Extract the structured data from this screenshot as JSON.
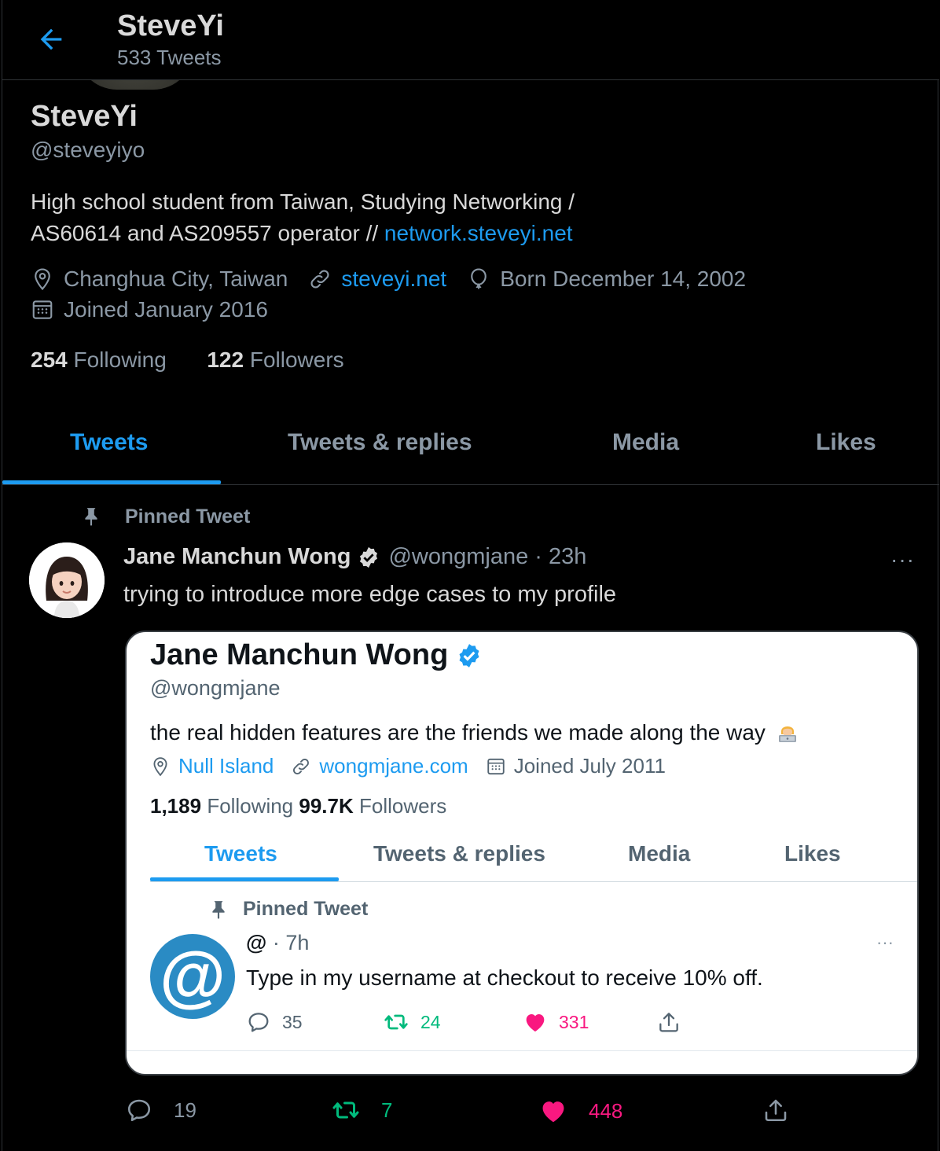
{
  "header": {
    "title": "SteveYi",
    "tweet_count": "533 Tweets"
  },
  "profile": {
    "name": "SteveYi",
    "handle": "@steveyiyo",
    "bio_line1": "High school student from Taiwan, Studying Networking /",
    "bio_line2": "AS60614 and AS209557 operator // ",
    "bio_link": "network.steveyi.net",
    "location": "Changhua City, Taiwan",
    "website": "steveyi.net",
    "birthday": "Born December 14, 2002",
    "joined": "Joined January 2016",
    "following_count": "254",
    "following_label": "Following",
    "followers_count": "122",
    "followers_label": "Followers"
  },
  "tabs": [
    {
      "label": "Tweets",
      "active": true
    },
    {
      "label": "Tweets & replies",
      "active": false
    },
    {
      "label": "Media",
      "active": false
    },
    {
      "label": "Likes",
      "active": false
    }
  ],
  "tweet": {
    "pinned_label": "Pinned Tweet",
    "author_name": "Jane Manchun Wong",
    "author_handle": "@wongmjane",
    "time": "· 23h",
    "more": "···",
    "text": "trying to introduce more edge cases to my profile",
    "reply_count": "19",
    "retweet_count": "7",
    "like_count": "448"
  },
  "embedded": {
    "name": "Jane Manchun Wong",
    "handle": "@wongmjane",
    "bio": "the real hidden features are the friends we made along the way",
    "location": "Null Island",
    "website": "wongmjane.com",
    "joined": "Joined July 2011",
    "following_count": "1,189",
    "following_label": "Following",
    "followers_count": "99.7K",
    "followers_label": "Followers",
    "tabs": [
      "Tweets",
      "Tweets & replies",
      "Media",
      "Likes"
    ],
    "pinned_label": "Pinned Tweet",
    "tweet_author": "@",
    "tweet_time": "· 7h",
    "tweet_more": "···",
    "tweet_text": "Type in my username at checkout to receive 10% off.",
    "avatar_glyph": "@",
    "reply_count": "35",
    "retweet_count": "24",
    "like_count": "331"
  },
  "colors": {
    "accent": "#1d9bf0",
    "retweet": "#00ba7c",
    "like": "#f91880",
    "muted": "#8b98a5",
    "background": "#000000"
  }
}
